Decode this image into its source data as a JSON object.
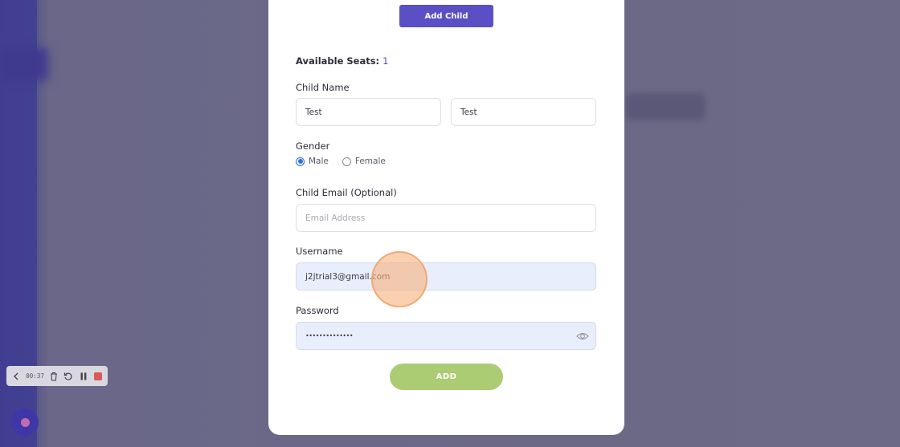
{
  "modal": {
    "add_child_label": "Add Child",
    "seats_label": "Available Seats:",
    "seats_value": "1",
    "child_name_label": "Child Name",
    "first_name_value": "Test",
    "last_name_value": "Test",
    "gender_label": "Gender",
    "gender_options": [
      "Male",
      "Female"
    ],
    "gender_selected": "Male",
    "email_label": "Child Email (Optional)",
    "email_placeholder": "Email Address",
    "username_label": "Username",
    "username_value": "j2jtrial3@gmail.com",
    "password_label": "Password",
    "password_value": "••••••••••••••",
    "add_label": "ADD"
  },
  "recorder": {
    "time": "00:37"
  },
  "colors": {
    "primary": "#5a4fc4",
    "add_button": "#abcc72",
    "filled_input": "#e8eefb"
  }
}
